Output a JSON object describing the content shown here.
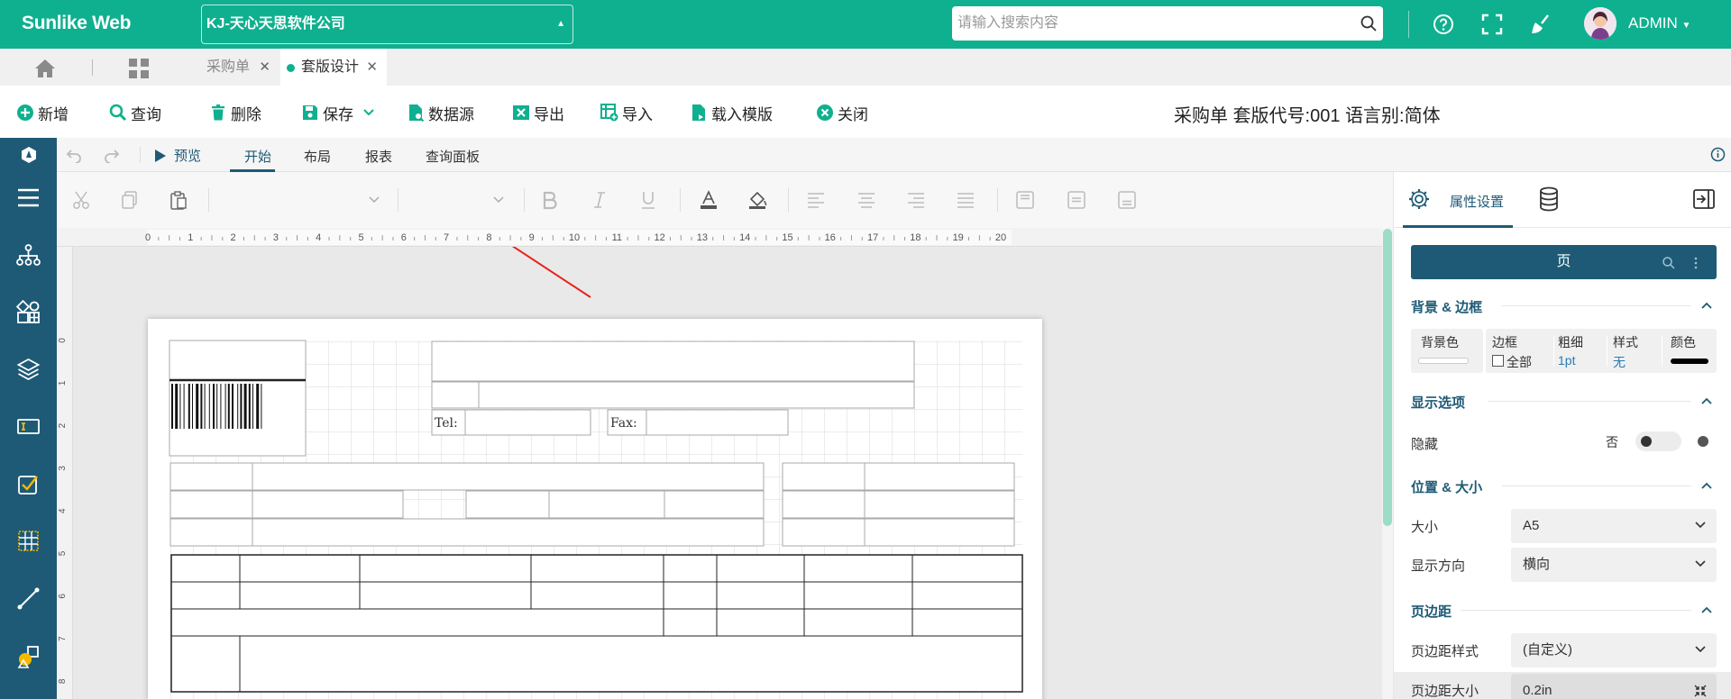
{
  "header": {
    "brand": "Sunlike Web",
    "company": "KJ-天心天思软件公司",
    "search_placeholder": "请输入搜索内容",
    "user": "ADMIN"
  },
  "tabs": {
    "items": [
      {
        "label": "采购单"
      },
      {
        "label": "套版设计"
      }
    ]
  },
  "toolbar": {
    "buttons": [
      {
        "label": "新增"
      },
      {
        "label": "查询"
      },
      {
        "label": "删除"
      },
      {
        "label": "保存"
      },
      {
        "label": "数据源"
      },
      {
        "label": "导出"
      },
      {
        "label": "导入"
      },
      {
        "label": "载入模版"
      },
      {
        "label": "关闭"
      }
    ],
    "info": "采购单 套版代号:001 语言别:简体"
  },
  "ribbon": {
    "preview": "预览",
    "tabs": [
      {
        "label": "开始"
      },
      {
        "label": "布局"
      },
      {
        "label": "报表"
      },
      {
        "label": "查询面板"
      }
    ]
  },
  "ruler": {
    "marks": [
      "0",
      "1",
      "2",
      "3",
      "4",
      "5",
      "6",
      "7",
      "8",
      "9",
      "10",
      "11",
      "12",
      "13",
      "14",
      "15",
      "16",
      "17",
      "18",
      "19",
      "20"
    ],
    "side_marks": [
      "0",
      "1",
      "2",
      "3",
      "4",
      "5",
      "6",
      "7",
      "8"
    ]
  },
  "report": {
    "tel_label": "Tel:",
    "fax_label": "Fax:"
  },
  "panel": {
    "tab_label": "属性设置",
    "section_title": "页",
    "bg_border": {
      "title": "背景 & 边框",
      "bg_color": "背景色",
      "border": "边框",
      "border_all": "全部",
      "weight": "粗细",
      "weight_value": "1pt",
      "style": "样式",
      "style_value": "无",
      "color": "颜色"
    },
    "display": {
      "title": "显示选项",
      "hide_label": "隐藏",
      "hide_value": "否"
    },
    "position": {
      "title": "位置 & 大小",
      "size_label": "大小",
      "size_value": "A5",
      "orient_label": "显示方向",
      "orient_value": "横向"
    },
    "margin": {
      "title": "页边距",
      "style_label": "页边距样式",
      "style_value": "(自定义)",
      "size_label": "页边距大小",
      "size_value": "0.2in"
    }
  },
  "colors": {
    "brand_green": "#0fb08f",
    "navy": "#1e5a76",
    "arrow_red": "#e8231c"
  }
}
